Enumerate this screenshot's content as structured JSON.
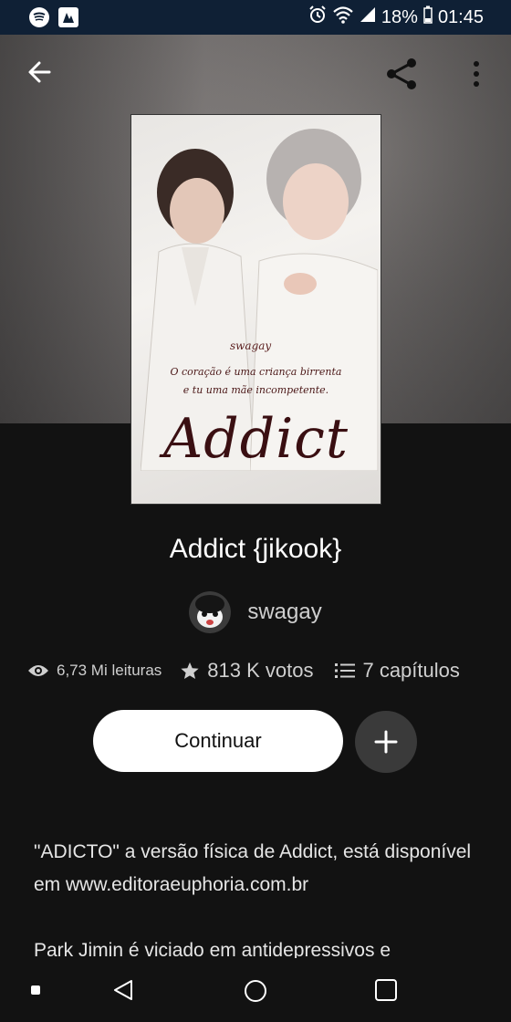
{
  "status_bar": {
    "battery": "18%",
    "time": "01:45",
    "icons": [
      "spotify-icon",
      "app-icon",
      "alarm-icon",
      "wifi-icon",
      "signal-icon",
      "battery-icon"
    ]
  },
  "toolbar": {
    "icons": [
      "back-arrow-icon",
      "share-icon",
      "more-vert-icon"
    ]
  },
  "cover": {
    "author": "swagay",
    "quote_line1": "O coração é uma criança birrenta",
    "quote_line2": "e tu uma mãe incompetente.",
    "title": "Addict"
  },
  "story": {
    "title": "Addict {jikook}",
    "author": "swagay",
    "reads": "6,73 Mi leituras",
    "votes": "813 K votos",
    "chapters": "7 capítulos"
  },
  "actions": {
    "continue_label": "Continuar",
    "add_label": "+"
  },
  "description": {
    "paragraph1": "\"ADICTO\" a versão física de Addict, está disponível em www.editoraeuphoria.com.br",
    "paragraph2": "Park Jimin é viciado em antidepressivos e"
  },
  "nav": {
    "icons": [
      "recents-dot-icon",
      "back-triangle-icon",
      "home-circle-icon",
      "overview-square-icon"
    ]
  }
}
